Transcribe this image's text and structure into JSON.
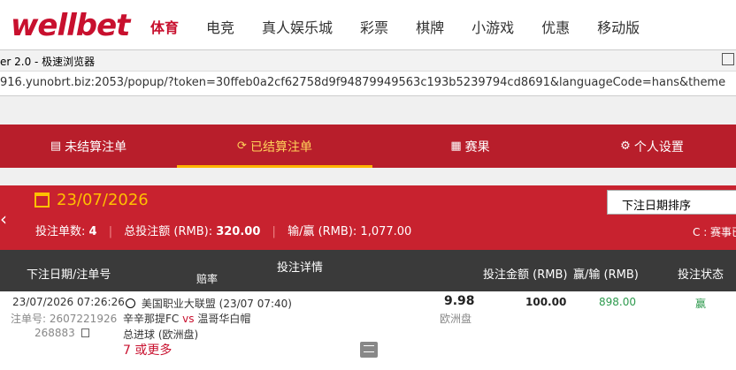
{
  "brand": {
    "logo": "wellbet",
    "color": "#c8102e"
  },
  "nav": [
    "体育",
    "电竞",
    "真人娱乐城",
    "彩票",
    "棋牌",
    "小游戏",
    "优惠",
    "移动版"
  ],
  "browser": {
    "title": "er 2.0 - 极速浏览器",
    "url": "916.yunobrt.biz:2053/popup/?token=30ffeb0a2cf62758d9f94879949563c193b5239794cd8691&languageCode=hans&theme"
  },
  "tabs": [
    {
      "icon": "▤",
      "label": "未结算注单"
    },
    {
      "icon": "⟳",
      "label": "已结算注单"
    },
    {
      "icon": "▦",
      "label": "赛果"
    },
    {
      "icon": "⚙",
      "label": "个人设置"
    }
  ],
  "summary": {
    "date": "23/07/2026",
    "count_label": "投注单数:",
    "count_value": "4",
    "total_label": "总投注额 (RMB):",
    "total_value": "320.00",
    "winloss_label": "输/赢 (RMB):",
    "winloss_value": "1,077.00",
    "sort_label": "下注日期排序",
    "scope_text": "C : 赛事已"
  },
  "table": {
    "headers": {
      "date_id": "下注日期/注单号",
      "details": "投注详情",
      "odds": "赔率",
      "stake": "投注金额 (RMB)",
      "winloss": "赢/输 (RMB)",
      "status": "投注状态"
    },
    "rows": [
      {
        "datetime": "23/07/2026 07:26:26",
        "id_label": "注单号:",
        "id_part1": "2607221926",
        "id_part2": "268883",
        "league": "美国职业大联盟 (23/07 07:40)",
        "home": "辛辛那提FC",
        "vs": "vs",
        "away": "温哥华白帽",
        "market": "总进球 (欧洲盘)",
        "selection": "7 或更多",
        "odds": "9.98",
        "odds_type": "欧洲盘",
        "stake": "100.00",
        "winloss": "898.00",
        "status": "赢"
      }
    ]
  },
  "colors": {
    "accent": "#c8222f",
    "gold": "#ffc000",
    "win": "#2e9a4e"
  }
}
